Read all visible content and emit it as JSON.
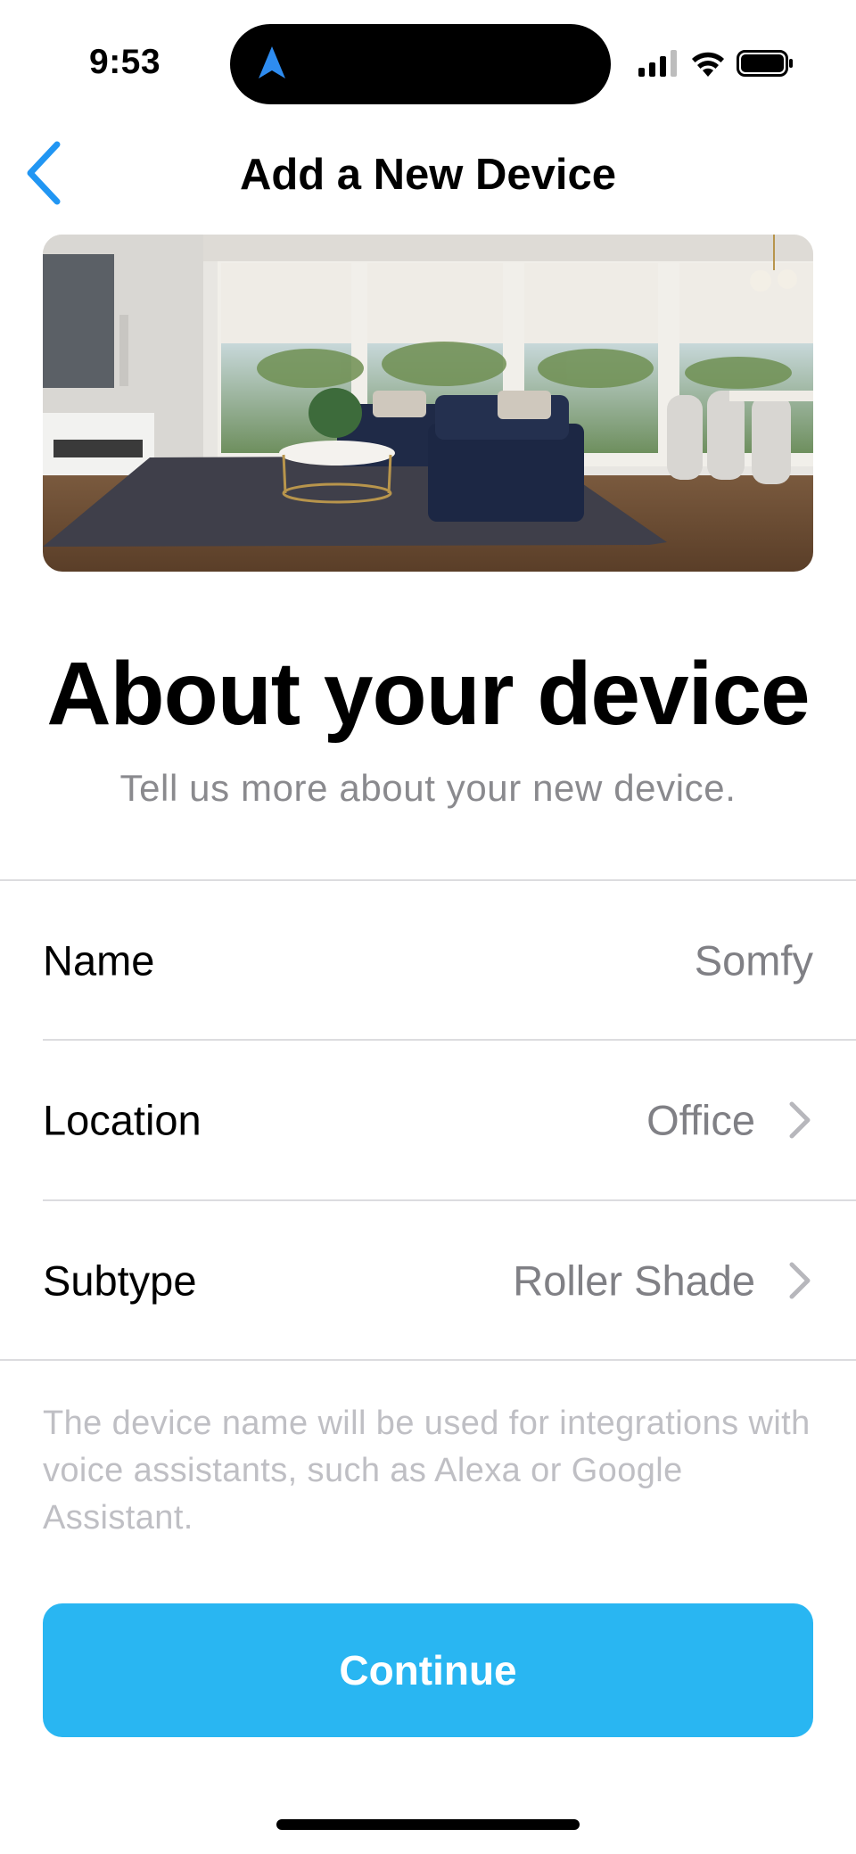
{
  "status_bar": {
    "time": "9:53"
  },
  "nav": {
    "title": "Add a New Device",
    "back_icon": "chevron-left-icon"
  },
  "hero": {
    "alt": "Living room with roller shades"
  },
  "heading": {
    "title": "About your device",
    "subtitle": "Tell us more about your new device."
  },
  "form": {
    "rows": [
      {
        "label": "Name",
        "value": "Somfy"
      },
      {
        "label": "Location",
        "value": "Office"
      },
      {
        "label": "Subtype",
        "value": "Roller Shade"
      }
    ],
    "note": "The device name will be used for integrations with voice assistants, such as Alexa or Google Assistant."
  },
  "actions": {
    "continue_label": "Continue"
  },
  "colors": {
    "accent": "#29b6f2",
    "back_arrow": "#2196f3",
    "secondary_text": "#808085",
    "note_text": "#bfbfc4"
  }
}
